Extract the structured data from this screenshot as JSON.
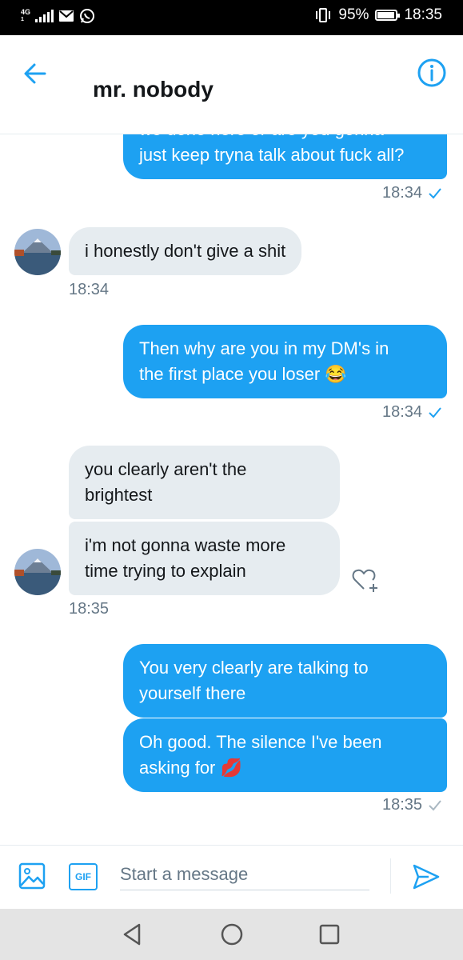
{
  "status_bar": {
    "network": "4G",
    "signal_sub": "1",
    "battery_percent": "95%",
    "battery_level": 0.95,
    "time": "18:35"
  },
  "header": {
    "title": "mr. nobody",
    "back_icon": "arrow-left-icon",
    "info_icon": "info-icon"
  },
  "colors": {
    "accent": "#1da1f2",
    "incoming_bubble": "#e6ecf0",
    "secondary_text": "#657786",
    "nav_bar": "#e4e4e4"
  },
  "messages": [
    {
      "direction": "out",
      "lines": [
        "we done here or are you gonna",
        "just keep tryna talk about fuck all?"
      ],
      "time": "18:34",
      "status": "sent-check"
    },
    {
      "direction": "in",
      "lines": [
        "i honestly don't give a shit"
      ],
      "time": "18:34"
    },
    {
      "direction": "out",
      "lines": [
        "Then why are you in my DM's in",
        "the first place you loser 😂"
      ],
      "time": "18:34",
      "status": "sent-check"
    },
    {
      "direction": "in",
      "lines": [
        "you clearly aren't the",
        "brightest"
      ]
    },
    {
      "direction": "in",
      "lines": [
        "i'm not gonna waste more",
        "time trying to explain"
      ],
      "time": "18:35",
      "reaction_icon": "heart-plus-icon"
    },
    {
      "direction": "out",
      "lines": [
        "You very clearly are talking to",
        "yourself there"
      ]
    },
    {
      "direction": "out",
      "lines": [
        "Oh good. The silence I've been",
        "asking for 💋"
      ],
      "time": "18:35",
      "status": "seen-check"
    }
  ],
  "composer": {
    "placeholder": "Start a message",
    "gif_label": "GIF",
    "media_icon": "image-icon",
    "send_icon": "send-icon"
  },
  "nav": {
    "back_icon": "nav-back-icon",
    "home_icon": "nav-home-icon",
    "recents_icon": "nav-recents-icon"
  }
}
